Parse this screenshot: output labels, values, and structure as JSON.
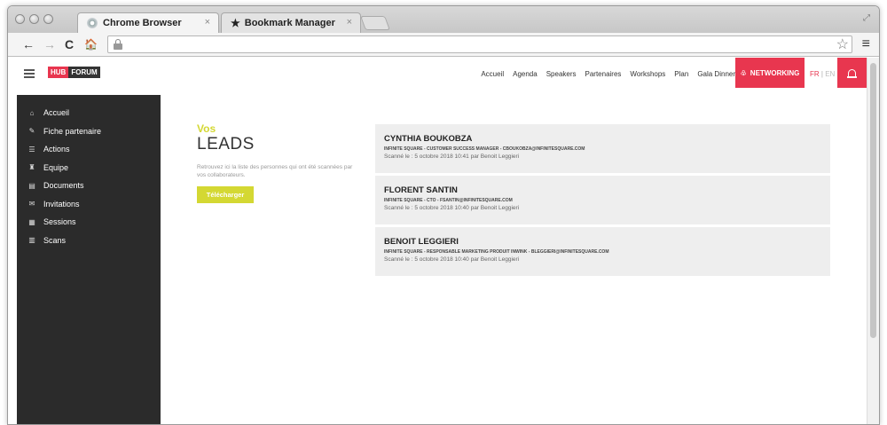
{
  "browser": {
    "tabs": [
      {
        "label": "Chrome Browser",
        "close": "×"
      },
      {
        "label": "Bookmark Manager",
        "close": "×"
      }
    ],
    "nav": {
      "back": "←",
      "forward": "→",
      "reload": "C",
      "home": "🏠"
    },
    "bookmark_star": "☆",
    "menu": "≡",
    "resize": "⤢"
  },
  "app": {
    "logo": {
      "part1": "HUB",
      "part2": "FORUM"
    },
    "topnav": [
      "Accueil",
      "Agenda",
      "Speakers",
      "Partenaires",
      "Workshops",
      "Plan",
      "Gala Dinner"
    ],
    "networking_label": "NETWORKING",
    "lang": {
      "fr": "FR",
      "sep": "|",
      "en": "EN"
    },
    "accent_color": "#e8364f",
    "highlight_color": "#d4d833"
  },
  "sidebar": {
    "items": [
      {
        "label": "Accueil",
        "icon": "home-icon"
      },
      {
        "label": "Fiche partenaire",
        "icon": "pencil-icon"
      },
      {
        "label": "Actions",
        "icon": "list-icon"
      },
      {
        "label": "Equipe",
        "icon": "team-icon"
      },
      {
        "label": "Documents",
        "icon": "document-icon"
      },
      {
        "label": "Invitations",
        "icon": "invitation-icon"
      },
      {
        "label": "Sessions",
        "icon": "sessions-icon"
      },
      {
        "label": "Scans",
        "icon": "scan-icon"
      }
    ]
  },
  "main": {
    "heading_small": "Vos",
    "heading_large": "LEADS",
    "description": "Retrouvez ici la liste des personnes qui ont été scannées par vos collaborateurs.",
    "download_label": "Télécharger",
    "leads": [
      {
        "name": "CYNTHIA BOUKOBZA",
        "meta": "INFINITE SQUARE - CUSTOMER SUCCESS MANAGER - CBOUKOBZA@INFINITESQUARE.COM",
        "scan": "Scanné le : 5 octobre 2018 10:41 par Benoit Leggieri"
      },
      {
        "name": "FLORENT SANTIN",
        "meta": "INFINITE SQUARE - CTO - FSANTIN@INFINITESQUARE.COM",
        "scan": "Scanné le : 5 octobre 2018 10:40 par Benoit Leggieri"
      },
      {
        "name": "BENOIT LEGGIERI",
        "meta": "INFINITE SQUARE - RESPONSABLE MARKETING PRODUIT INWINK - BLEGGIERI@INFINITESQUARE.COM",
        "scan": "Scanné le : 5 octobre 2018 10:40 par Benoit Leggieri"
      }
    ]
  }
}
